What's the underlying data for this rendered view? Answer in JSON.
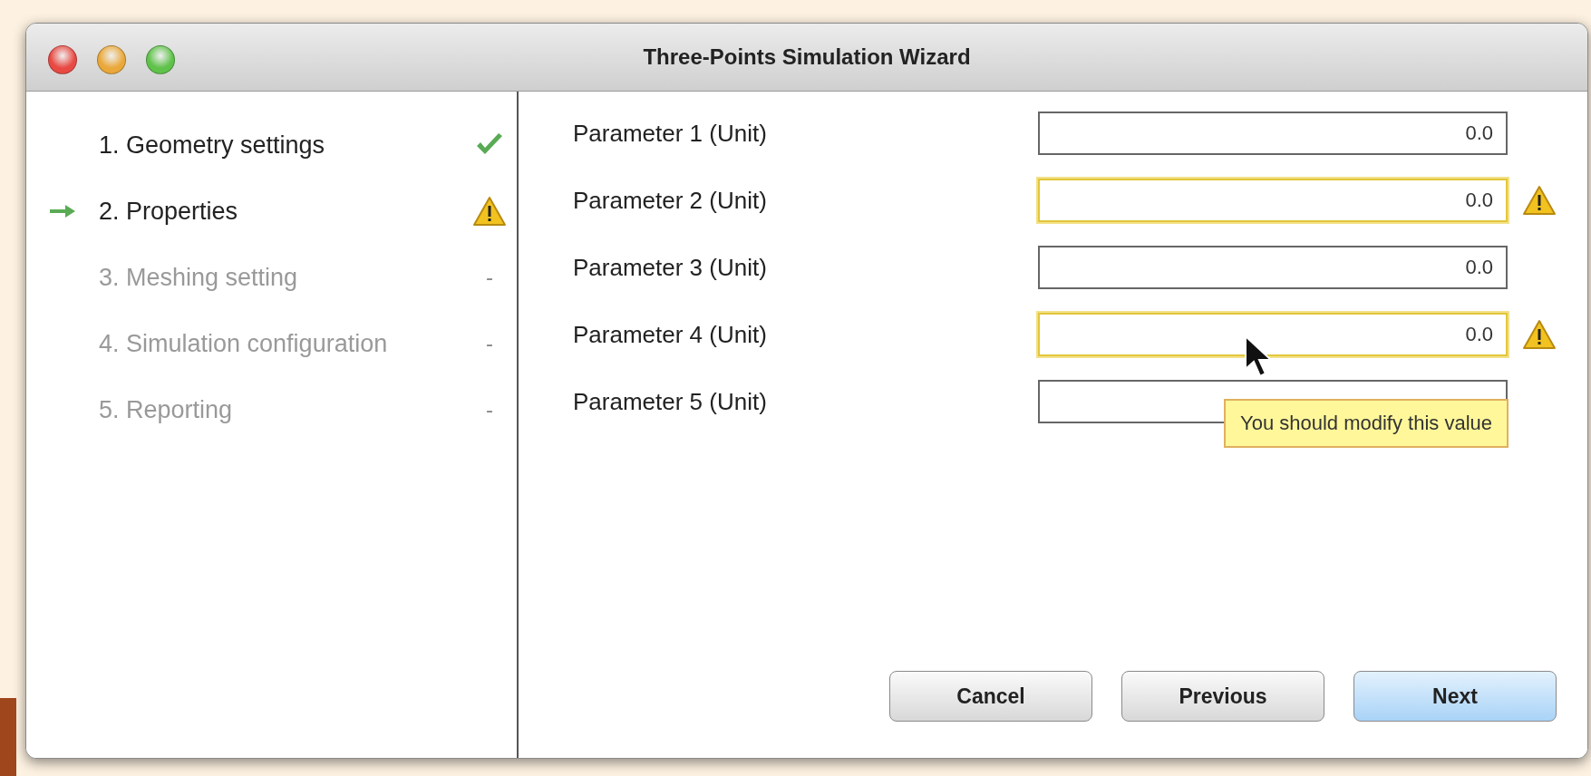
{
  "window": {
    "title": "Three-Points Simulation Wizard"
  },
  "steps": [
    {
      "label": "1. Geometry settings",
      "selected": false,
      "disabled": false,
      "kind": "done"
    },
    {
      "label": "2. Properties",
      "selected": true,
      "disabled": false,
      "kind": "warning"
    },
    {
      "label": "3. Meshing setting",
      "selected": false,
      "disabled": true,
      "kind": "pending",
      "marker": "-"
    },
    {
      "label": "4. Simulation configuration",
      "selected": false,
      "disabled": true,
      "kind": "pending",
      "marker": "-"
    },
    {
      "label": "5. Reporting",
      "selected": false,
      "disabled": true,
      "kind": "pending",
      "marker": "-"
    }
  ],
  "parameters": [
    {
      "label": "Parameter 1 (Unit)",
      "value": "0.0",
      "warning": false
    },
    {
      "label": "Parameter 2 (Unit)",
      "value": "0.0",
      "warning": true
    },
    {
      "label": "Parameter 3 (Unit)",
      "value": "0.0",
      "warning": false
    },
    {
      "label": "Parameter 4 (Unit)",
      "value": "0.0",
      "warning": true
    },
    {
      "label": "Parameter 5 (Unit)",
      "warning": false
    }
  ],
  "tooltip": {
    "text": "You should modify this value"
  },
  "buttons": [
    {
      "label": "Cancel",
      "default": false
    },
    {
      "label": "Previous",
      "default": false
    },
    {
      "label": "Next",
      "default": true
    }
  ]
}
